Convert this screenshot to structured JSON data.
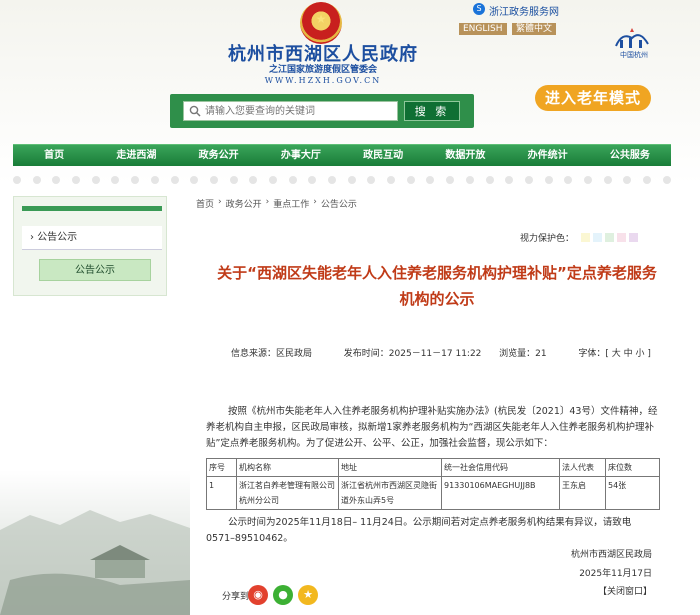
{
  "header": {
    "title": "杭州市西湖区人民政府",
    "subtitle": "之江国家旅游度假区管委会",
    "url": "WWW.HZXH.GOV.CN",
    "zj_link": "浙江政务服务网",
    "lang_en": "ENGLISH",
    "lang_tc": "繁體中文",
    "city_logo_text": "中国杭州",
    "elder_mode": "进入老年模式"
  },
  "search": {
    "placeholder": "请输入您要查询的关键词",
    "button": "搜  索"
  },
  "nav": {
    "items": [
      "首页",
      "走进西湖",
      "政务公开",
      "办事大厅",
      "政民互动",
      "数据开放",
      "办件统计",
      "公共服务"
    ]
  },
  "sidebar": {
    "menu_item": "公告公示",
    "button": "公告公示"
  },
  "breadcrumb": [
    "首页",
    "›",
    "政务公开",
    "›",
    "重点工作",
    "›",
    "公告公示"
  ],
  "vision": {
    "label": "视力保护色：",
    "swatches": [
      "#fbf7d3",
      "#e4f3fb",
      "#dff0df",
      "#f8e1ea",
      "#ead9ef"
    ]
  },
  "article": {
    "title": "关于“西湖区失能老年人入住养老服务机构护理补贴”定点养老服务机构的公示",
    "source_label": "信息来源：",
    "source": "区民政局",
    "time_label": "发布时间：",
    "time": "2025－11－17 11:22",
    "views_label": "浏览量：",
    "views": "21",
    "font_label": "字体：[ 大 中 小 ]",
    "body": "按照《杭州市失能老年人入住养老服务机构护理补贴实施办法》(杭民发〔2021〕43号）文件精神，经养老机构自主申报，区民政局审核，拟新增1家养老服务机构为“西湖区失能老年人入住养老服务机构护理补贴”定点养老服务机构。为了促进公开、公平、公正，加强社会监督，现公示如下：",
    "table": {
      "headers": [
        "序号",
        "机构名称",
        "地址",
        "统一社会信用代码",
        "法人代表",
        "床位数"
      ],
      "rows": [
        [
          "1",
          "浙江茗白养老管理有限公司杭州分公司",
          "浙江省杭州市西湖区灵隐街道外东山弄5号",
          "91330106MAEGHUJJ8B",
          "王东启",
          "54张"
        ]
      ]
    },
    "notice": "公示时间为2025年11月18日– 11月24日。公示期间若对定点养老服务机构结果有异议，请致电0571–89510462。",
    "sign_org": "杭州市西湖区民政局",
    "sign_date": "2025年11月17日",
    "close": "【关闭窗口】",
    "share_label": "分享到："
  },
  "colors": {
    "nav_green": "#197c38",
    "title_red": "#c03b18",
    "elder_orange": "#f0a522",
    "header_blue": "#1d4fa0"
  }
}
